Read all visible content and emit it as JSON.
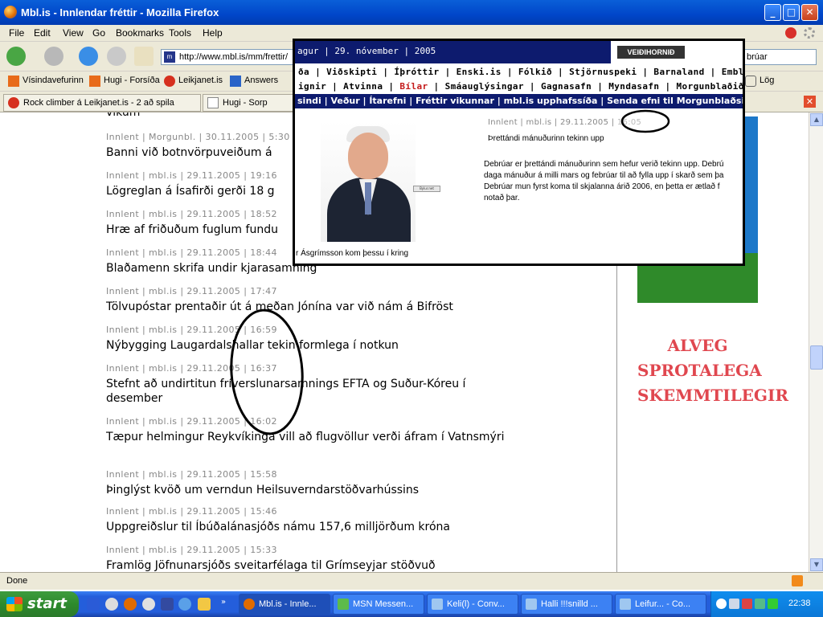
{
  "window": {
    "title": "Mbl.is - Innlendar fréttir - Mozilla Firefox",
    "minimize": "_",
    "maximize": "□",
    "close": "✕"
  },
  "menu": [
    "File",
    "Edit",
    "View",
    "Go",
    "Bookmarks",
    "Tools",
    "Help"
  ],
  "nav": {
    "url": "http://www.mbl.is/mm/frettir/",
    "url_icon": "m",
    "search_value": "brúar",
    "icons": [
      "back-arrow-icon",
      "forward-arrow-icon",
      "reload-icon",
      "stop-icon",
      "home-icon"
    ]
  },
  "bookmarks": [
    {
      "label": "Vísindavefurinn",
      "icon": "h-icon",
      "color": "#e86b1a"
    },
    {
      "label": "Hugi - Forsíða",
      "icon": "h-icon",
      "color": "#e86b1a"
    },
    {
      "label": "Leikjanet.is",
      "icon": "red-ball-icon",
      "color": "#d6301e"
    },
    {
      "label": "Answers",
      "icon": "answers-icon",
      "color": "#2a64c8"
    },
    {
      "label": "Lög",
      "icon": "bookmark-icon",
      "color": "#666666"
    }
  ],
  "tabs": [
    {
      "label": "Rock climber á Leikjanet.is - 2 að spila",
      "icon": "red-ball-icon"
    },
    {
      "label": "Hugi - Sorp",
      "icon": "page-icon"
    }
  ],
  "articles": [
    {
      "meta": "Innlent | Morgunbl. | 30.11.2005 | 5:30",
      "title": "Banni við botnvörpuveiðum á"
    },
    {
      "meta": "Innlent | mbl.is | 29.11.2005 | 19:16",
      "title": "Lögreglan á Ísafirði gerði 18 g"
    },
    {
      "meta": "Innlent | mbl.is | 29.11.2005 | 18:52",
      "title": "Hræ af friðuðum fuglum fundu"
    },
    {
      "meta": "Innlent | mbl.is | 29.11.2005 | 18:44",
      "title": "Blaðamenn skrifa undir kjarasamning"
    },
    {
      "meta": "Innlent | mbl.is | 29.11.2005 | 17:47",
      "title": "Tölvupóstar prentaðir út á meðan Jónína var við nám á Bifröst"
    },
    {
      "meta": "Innlent | mbl.is | 29.11.2005 | 16:59",
      "title": "Nýbygging Laugardalshallar tekin formlega í notkun"
    },
    {
      "meta": "Innlent | mbl.is | 29.11.2005 | 16:37",
      "title": "Stefnt að undirtitun fríverslunarsamnings EFTA og Suður-Kóreu í desember"
    },
    {
      "meta": "Innlent | mbl.is | 29.11.2005 | 16:02",
      "title": "Tæpur helmingur Reykvíkinga vill að flugvöllur verði áfram í Vatnsmýri"
    },
    {
      "meta": "Innlent | mbl.is | 29.11.2005 | 15:58",
      "title": "Þinglýst kvöð um verndun Heilsuverndarstöðvarhússins"
    },
    {
      "meta": "Innlent | mbl.is | 29.11.2005 | 15:46",
      "title": "Uppgreiðslur til Íbúðalánasjóðs námu 157,6 milljörðum króna"
    },
    {
      "meta": "Innlent | mbl.is | 29.11.2005 | 15:33",
      "title": "Framlög Jöfnunarsjóðs sveitarfélaga til Grímseyjar stöðvuð"
    }
  ],
  "top_partial_title": "vikum",
  "ad": {
    "lines": [
      "ALVEG",
      "SPROTALEGA",
      "SKEMMTILEGIR"
    ],
    "text_color": "#e0474f",
    "corner_text": "VEIÐIHORNIÐ"
  },
  "status": "Done",
  "popup": {
    "date_bar": "agur | 29. nóvember | 2005",
    "nav1": "ða | Viðskipti | Íþróttir | Enski.is | Fólkið | Stjörnuspeki | Barnaland | Embla |",
    "nav2_pre": "ignir | Atvinna | ",
    "nav2_red": "Bílar",
    "nav2_post": " | Smáauglýsingar | Gagnasafn | Myndasafn | Morgunblaðið",
    "nav3": "sindi | Veður | Ítarefni | Fréttir vikunnar | mbl.is upphafssíða | Senda efni til Morgunblaðsins | GSM þ",
    "meta": "Innlent | mbl.is | 29.11.2005 | ",
    "meta_time": "16:05",
    "headline": "Þrettándi mánuðurinn tekinn upp",
    "body": [
      "Debrúar er þrettándi mánuðurinn sem hefur verið tekinn upp. Debrú",
      "daga mánuður á milli mars og febrúar til að fylla upp í skarð sem þa",
      "Debrúar mun fyrst koma til skjalanna árið 2006, en þetta er ætlað f",
      "notað þar."
    ],
    "caption": "r Ásgrímsson kom þessu í kring",
    "plate_label": "Bylur.net"
  },
  "taskbar": {
    "start": "start",
    "items": [
      {
        "label": "Mbl.is - Innle...",
        "icon": "firefox-icon"
      },
      {
        "label": "MSN Messen...",
        "icon": "msn-icon"
      },
      {
        "label": "Keli(l) - Conv...",
        "icon": "conversation-icon"
      },
      {
        "label": "Halli !!!snilld ...",
        "icon": "conversation-icon"
      },
      {
        "label": "Leifur... - Co...",
        "icon": "conversation-icon"
      }
    ],
    "clock": "22:38"
  },
  "colors": {
    "title_blue": "#0046c9",
    "popup_bar": "#0d1b6e",
    "meta_gray": "#888888",
    "red_link": "#c41a1a"
  }
}
